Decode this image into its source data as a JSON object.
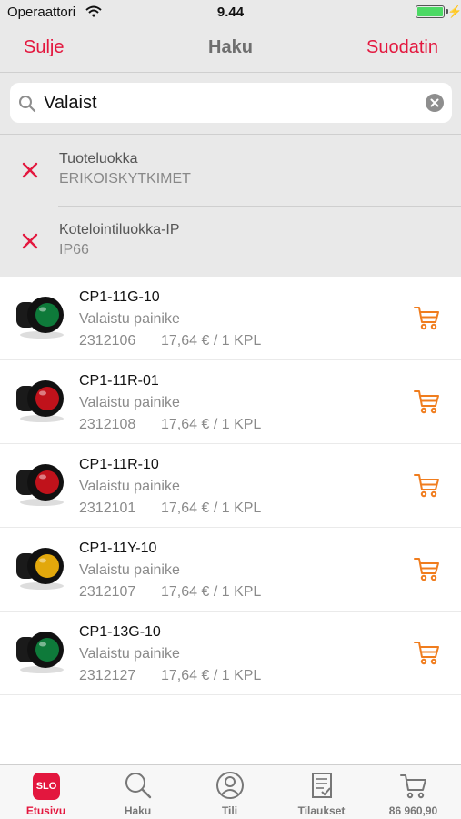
{
  "status_bar": {
    "carrier": "Operaattori",
    "time": "9.44"
  },
  "nav": {
    "left_label": "Sulje",
    "title": "Haku",
    "right_label": "Suodatin",
    "accent": "#e3173e"
  },
  "search": {
    "value": "Valaist"
  },
  "filters": [
    {
      "title": "Tuoteluokka",
      "value": "ERIKOISKYTKIMET"
    },
    {
      "title": "Kotelointiluokka-IP",
      "value": "IP66"
    }
  ],
  "products": [
    {
      "name": "CP1-11G-10",
      "description": "Valaistu painike",
      "code": "2312106",
      "price": "17,64 € / 1 KPL",
      "lamp_color": "#0e7a3a"
    },
    {
      "name": "CP1-11R-01",
      "description": "Valaistu painike",
      "code": "2312108",
      "price": "17,64 € / 1 KPL",
      "lamp_color": "#c0121b"
    },
    {
      "name": "CP1-11R-10",
      "description": "Valaistu painike",
      "code": "2312101",
      "price": "17,64 € / 1 KPL",
      "lamp_color": "#c0121b"
    },
    {
      "name": "CP1-11Y-10",
      "description": "Valaistu painike",
      "code": "2312107",
      "price": "17,64 € / 1 KPL",
      "lamp_color": "#e2a80c"
    },
    {
      "name": "CP1-13G-10",
      "description": "Valaistu painike",
      "code": "2312127",
      "price": "17,64 € / 1 KPL",
      "lamp_color": "#0e7a3a"
    }
  ],
  "tab_bar": {
    "logo_text": "SLO",
    "tabs": [
      {
        "label": "Etusivu",
        "icon": "home-logo-icon",
        "active": true
      },
      {
        "label": "Haku",
        "icon": "search-icon"
      },
      {
        "label": "Tili",
        "icon": "account-icon"
      },
      {
        "label": "Tilaukset",
        "icon": "orders-icon"
      },
      {
        "label": "86 960,90",
        "icon": "cart-icon"
      }
    ]
  }
}
